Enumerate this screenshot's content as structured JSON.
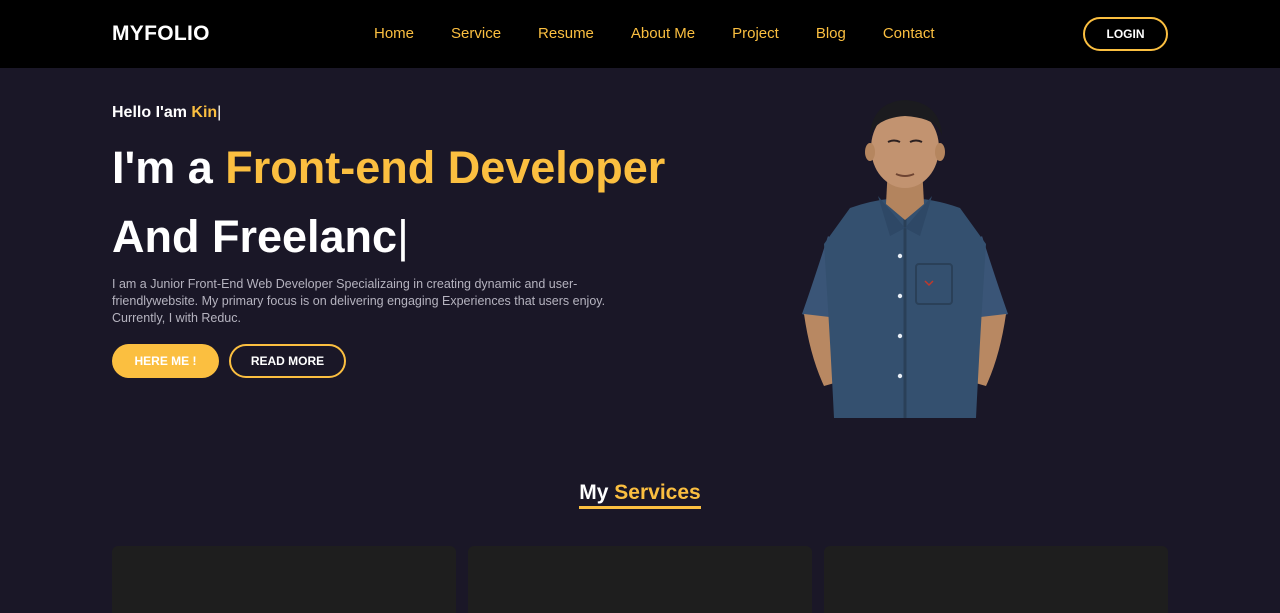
{
  "brand": {
    "logo": "MYFOLIO"
  },
  "nav": {
    "items": [
      "Home",
      "Service",
      "Resume",
      "About Me",
      "Project",
      "Blog",
      "Contact"
    ],
    "login_label": "LOGIN"
  },
  "hero": {
    "hello_prefix": "Hello I'am ",
    "hello_name": "Kin",
    "caret": "|",
    "title_prefix": "I'm a ",
    "title_role": "Front-end Developer",
    "title_line2": "And Freelanc",
    "description": "I am a Junior Front-End Web Developer Specializaing in creating dynamic and user-friendlywebsite. My primary focus is on delivering engaging Experiences that users enjoy. Currently, I with Reduc.",
    "primary_button": "HERE ME !",
    "secondary_button": "READ MORE"
  },
  "services": {
    "title_prefix": "My ",
    "title_highlight": "Services"
  },
  "colors": {
    "accent": "#fbbf40",
    "background": "#1a1727",
    "navbar": "#000000",
    "card": "#1e1e1e"
  }
}
